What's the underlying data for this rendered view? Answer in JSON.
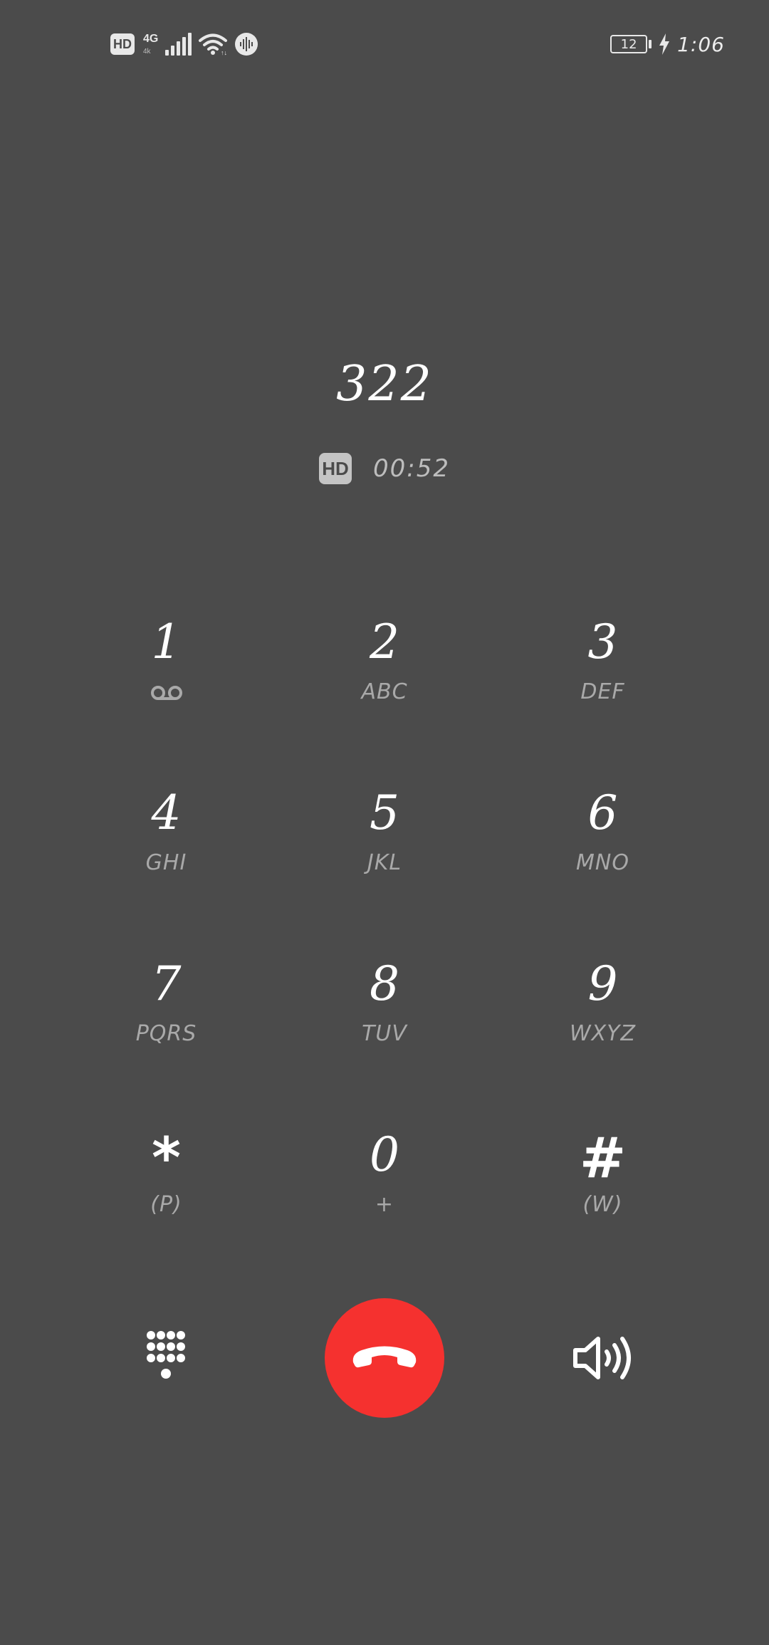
{
  "status_bar": {
    "hd_label": "HD",
    "network_type": "4G",
    "network_sub": "4k",
    "battery_level": "12",
    "time": "1:06"
  },
  "call": {
    "number": "322",
    "hd_label": "HD",
    "duration": "00:52"
  },
  "keypad": {
    "keys": [
      {
        "digit": "1",
        "letters": ""
      },
      {
        "digit": "2",
        "letters": "ABC"
      },
      {
        "digit": "3",
        "letters": "DEF"
      },
      {
        "digit": "4",
        "letters": "GHI"
      },
      {
        "digit": "5",
        "letters": "JKL"
      },
      {
        "digit": "6",
        "letters": "MNO"
      },
      {
        "digit": "7",
        "letters": "PQRS"
      },
      {
        "digit": "8",
        "letters": "TUV"
      },
      {
        "digit": "9",
        "letters": "WXYZ"
      },
      {
        "digit": "*",
        "letters": "(P)"
      },
      {
        "digit": "0",
        "letters": "+"
      },
      {
        "digit": "#",
        "letters": "(W)"
      }
    ]
  },
  "controls": {
    "left_icon": "dialpad-icon",
    "center_icon": "end-call-icon",
    "right_icon": "speaker-icon"
  },
  "colors": {
    "background": "#4b4b4b",
    "end_call": "#f5312f",
    "secondary_text": "#a9a9a9"
  }
}
